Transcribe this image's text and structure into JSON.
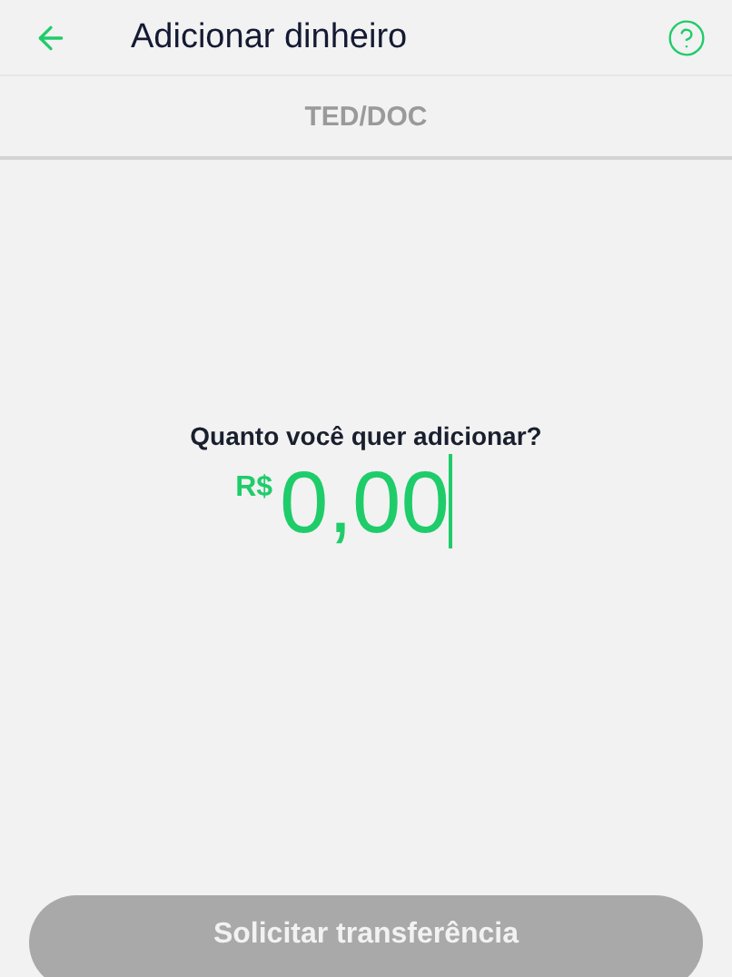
{
  "header": {
    "title": "Adicionar dinheiro"
  },
  "tab": {
    "label": "TED/DOC"
  },
  "amount": {
    "question": "Quanto você quer adicionar?",
    "currency": "R$",
    "value": "0,00",
    "focused": true
  },
  "submit": {
    "label": "Solicitar transferência",
    "disabled": true
  }
}
